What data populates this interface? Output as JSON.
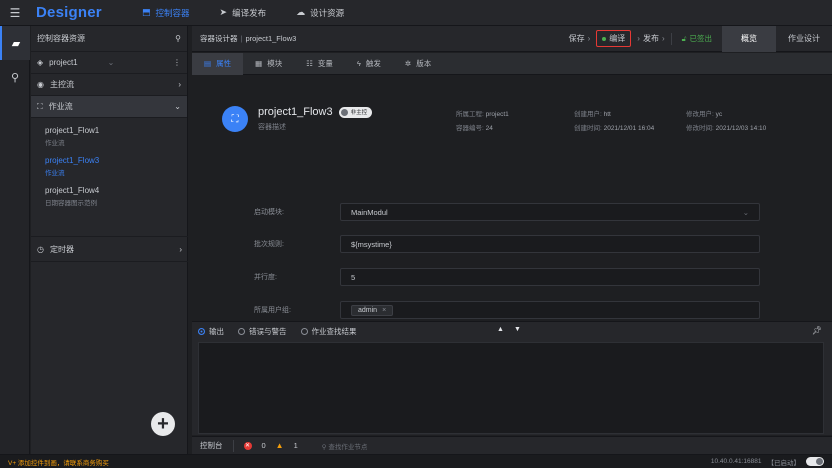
{
  "app": {
    "brand": "Designer",
    "menu_icon": "hamburger-icon"
  },
  "topnav": [
    {
      "label": "控制容器",
      "icon": "tag-icon",
      "active": true
    },
    {
      "label": "编译发布",
      "icon": "send-icon",
      "active": false
    },
    {
      "label": "设计资源",
      "icon": "cloud-icon",
      "active": false
    }
  ],
  "panel": {
    "title": "控制容器资源",
    "project": "project1",
    "nodes": {
      "main_flow": "主控流",
      "job_flow": "作业流",
      "timer": "定时器"
    },
    "flows": [
      {
        "name": "project1_Flow1",
        "sub": "作业流",
        "active": false
      },
      {
        "name": "project1_Flow3",
        "sub": "作业流",
        "active": true
      },
      {
        "name": "project1_Flow4",
        "sub": "日期容器图示范例",
        "active": false
      }
    ]
  },
  "designer": {
    "breadcrumb_root": "容器设计器",
    "breadcrumb_current": "project1_Flow3",
    "save": "保存",
    "compile": "编译",
    "publish": "发布",
    "signed": "已签出",
    "tab_overview": "概览",
    "tab_job_design": "作业设计"
  },
  "subtabs": [
    {
      "label": "属性",
      "icon": "list-icon",
      "active": true
    },
    {
      "label": "模块",
      "icon": "grid-icon",
      "active": false
    },
    {
      "label": "变量",
      "icon": "sliders-icon",
      "active": false
    },
    {
      "label": "触发",
      "icon": "bolt-icon",
      "active": false
    },
    {
      "label": "版本",
      "icon": "gear-icon",
      "active": false
    }
  ],
  "flow": {
    "name": "project1_Flow3",
    "toggle_label": "非主控",
    "desc": "容器描述",
    "meta": [
      {
        "key": "所属工程:",
        "value": "project1"
      },
      {
        "key": "容器编号:",
        "value": "24"
      },
      {
        "key": "创建用户:",
        "value": "htt"
      },
      {
        "key": "创建时间:",
        "value": "2021/12/01 16:04"
      },
      {
        "key": "修改用户:",
        "value": "yc"
      },
      {
        "key": "修改时间:",
        "value": "2021/12/03 14:10"
      }
    ]
  },
  "form": {
    "start_module_label": "启动模块:",
    "start_module_value": "MainModul",
    "batch_rule_label": "批次规则:",
    "batch_rule_value": "${msystime}",
    "parallel_label": "并行度:",
    "parallel_value": "5",
    "user_group_label": "所属用户组:",
    "user_group_value": "admin"
  },
  "output": {
    "tabs": [
      "输出",
      "错误与警告",
      "作业查找结果"
    ],
    "console_label": "控制台",
    "error_count": "0",
    "warning_count": "1",
    "search_placeholder": "查找作业节点"
  },
  "status": {
    "message": "V+ 添加控件到画，请联系商务购买",
    "server": "10.40.0.41:16881",
    "state": "【已启动】"
  }
}
